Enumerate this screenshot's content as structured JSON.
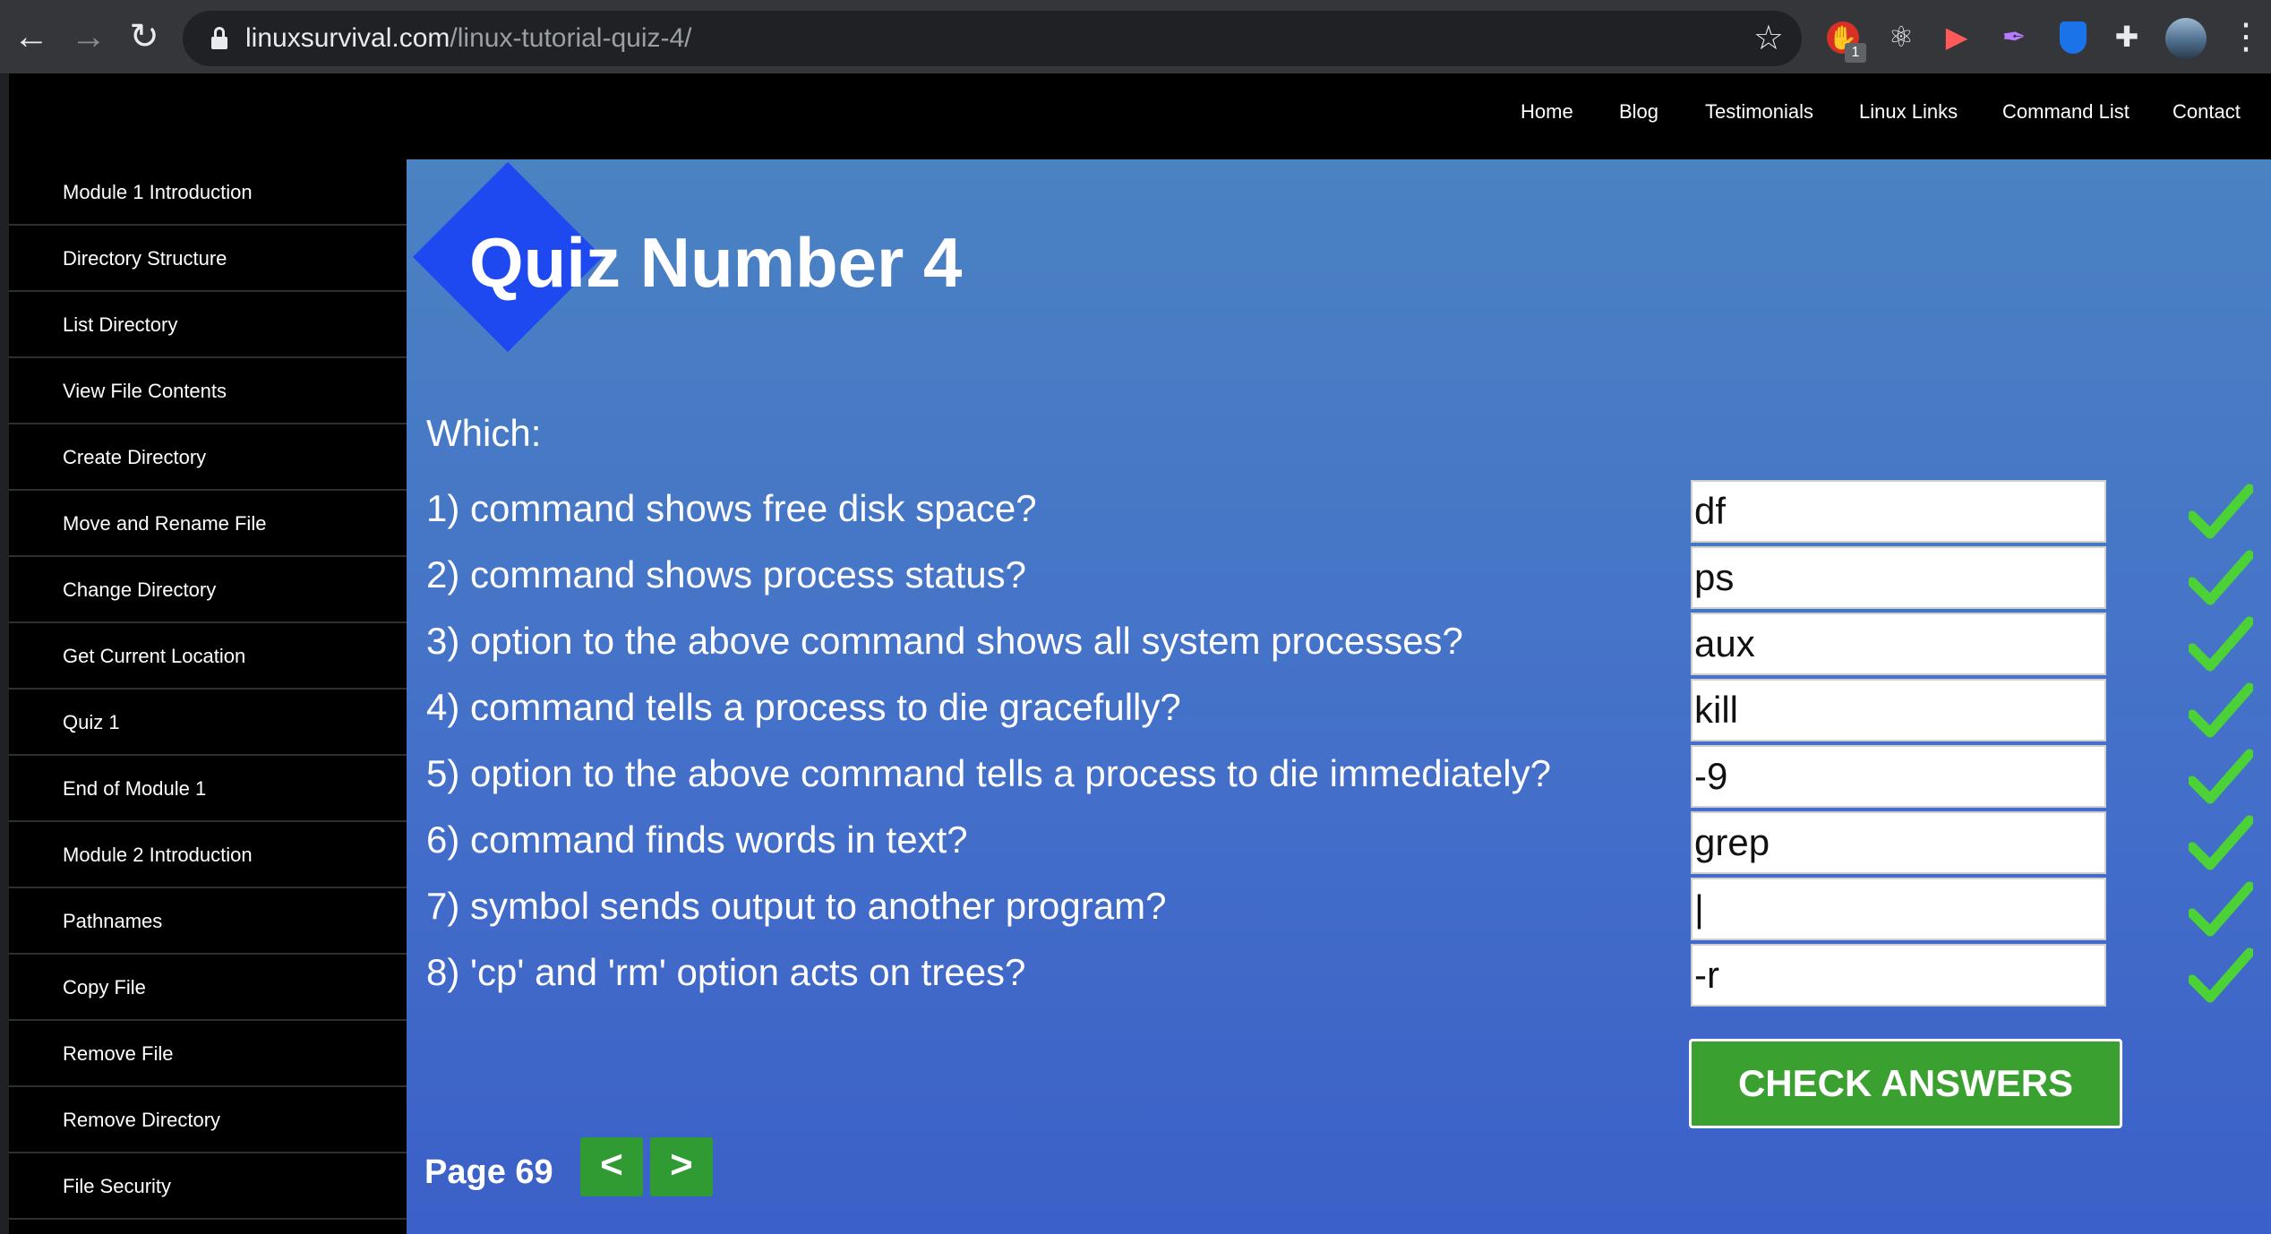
{
  "browser": {
    "url_host": "linuxsurvival.com",
    "url_path": "/linux-tutorial-quiz-4/",
    "extension_badge": "1",
    "icons": [
      "back-icon",
      "forward-icon",
      "reload-icon",
      "lock-icon",
      "bookmark-star-icon",
      "stop-sign-extension-icon",
      "react-extension-icon",
      "video-extension-icon",
      "feather-extension-icon",
      "shield-extension-icon",
      "puzzle-extensions-icon",
      "profile-avatar",
      "kebab-menu-icon"
    ]
  },
  "topnav": {
    "items": [
      "Home",
      "Blog",
      "Testimonials",
      "Linux Links",
      "Command List",
      "Contact"
    ]
  },
  "sidebar": {
    "items": [
      "Module 1 Introduction",
      "Directory Structure",
      "List Directory",
      "View File Contents",
      "Create Directory",
      "Move and Rename File",
      "Change Directory",
      "Get Current Location",
      "Quiz 1",
      "End of Module 1",
      "Module 2 Introduction",
      "Pathnames",
      "Copy File",
      "Remove File",
      "Remove Directory",
      "File Security"
    ]
  },
  "quiz": {
    "title": "Quiz Number 4",
    "intro": "Which:",
    "questions": [
      {
        "text": "1) command shows free disk space?",
        "answer": "df",
        "correct": true
      },
      {
        "text": "2) command shows process status?",
        "answer": "ps",
        "correct": true
      },
      {
        "text": "3) option to the above command shows all system processes?",
        "answer": "aux",
        "correct": true
      },
      {
        "text": "4) command tells a process to die gracefully?",
        "answer": "kill",
        "correct": true
      },
      {
        "text": "5) option to the above command tells a process to die immediately?",
        "answer": "-9",
        "correct": true
      },
      {
        "text": "6) command finds words in text?",
        "answer": "grep",
        "correct": true
      },
      {
        "text": "7) symbol sends output to another program?",
        "answer": "|",
        "correct": true
      },
      {
        "text": "8) 'cp' and 'rm' option acts on trees?",
        "answer": "-r",
        "correct": true
      }
    ],
    "check_button_label": "CHECK ANSWERS"
  },
  "pager": {
    "label": "Page 69",
    "prev_label": "<",
    "next_label": ">"
  },
  "colors": {
    "content_gradient_top": "#4a82c2",
    "content_gradient_bottom": "#3b60c8",
    "logo_diamond": "#1f49f0",
    "check_green": "#4cd137",
    "button_green": "#3aa02f"
  }
}
